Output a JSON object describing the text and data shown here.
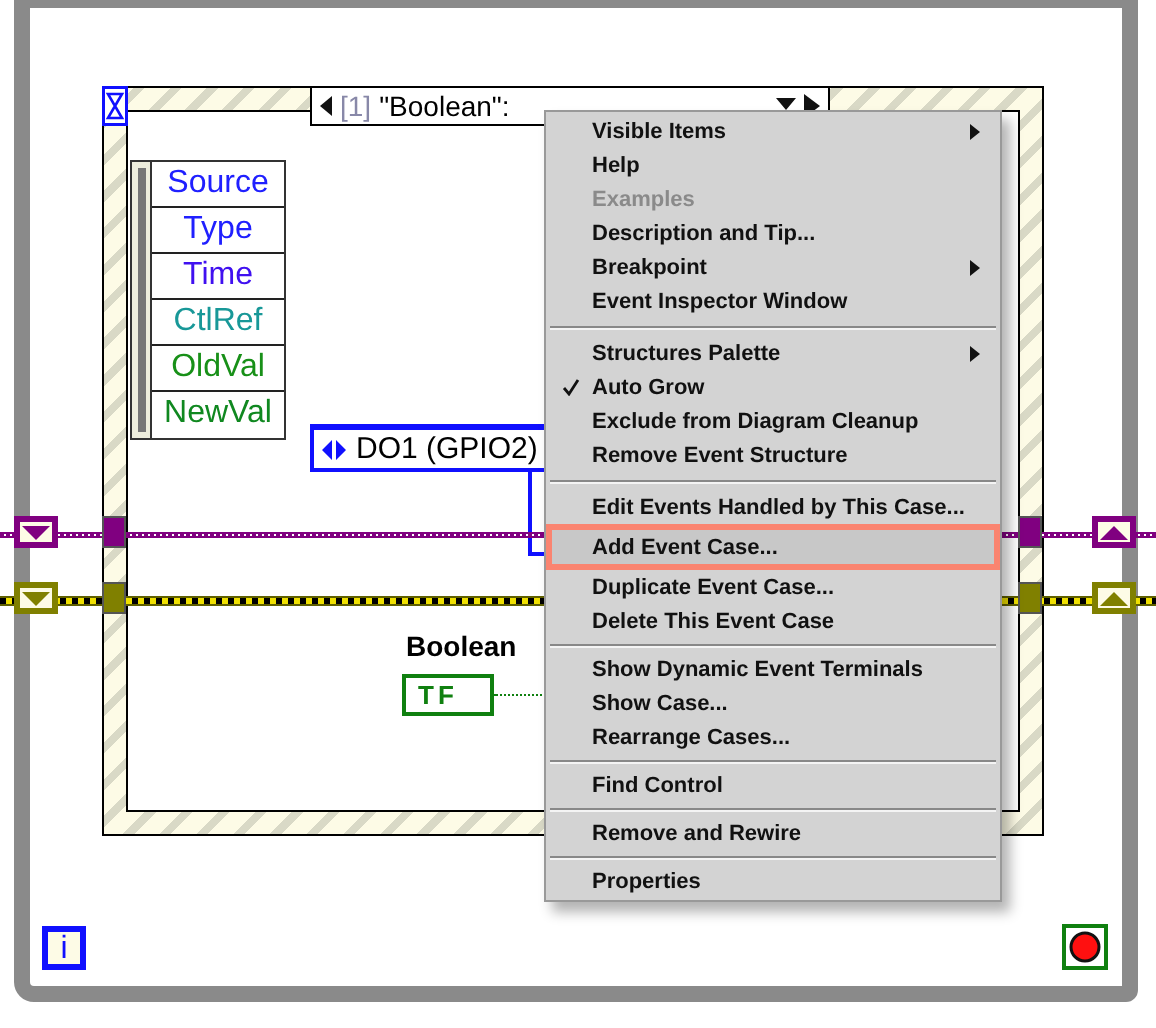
{
  "event_structure": {
    "selector": {
      "index": "[1]",
      "label": "\"Boolean\":"
    },
    "event_data": [
      {
        "label": "Source",
        "color": "#2020ff"
      },
      {
        "label": "Type",
        "color": "#2020ff"
      },
      {
        "label": "Time",
        "color": "#4010f0"
      },
      {
        "label": "CtlRef",
        "color": "#189898"
      },
      {
        "label": "OldVal",
        "color": "#189018"
      },
      {
        "label": "NewVal",
        "color": "#108820"
      }
    ],
    "reference_node": {
      "label": "DO1 (GPIO2)"
    },
    "control": {
      "label": "Boolean",
      "terminal": "TF"
    }
  },
  "shift_registers": [
    {
      "color": "#800080"
    },
    {
      "color": "#808000"
    }
  ],
  "iteration_terminal": "i",
  "context_menu": {
    "sections": [
      {
        "items": [
          {
            "label": "Visible Items",
            "submenu": true,
            "disabled": false,
            "checked": false,
            "highlighted": false
          },
          {
            "label": "Help",
            "submenu": false,
            "disabled": false,
            "checked": false,
            "highlighted": false
          },
          {
            "label": "Examples",
            "submenu": false,
            "disabled": true,
            "checked": false,
            "highlighted": false
          },
          {
            "label": "Description and Tip...",
            "submenu": false,
            "disabled": false,
            "checked": false,
            "highlighted": false
          },
          {
            "label": "Breakpoint",
            "submenu": true,
            "disabled": false,
            "checked": false,
            "highlighted": false
          },
          {
            "label": "Event Inspector Window",
            "submenu": false,
            "disabled": false,
            "checked": false,
            "highlighted": false
          }
        ]
      },
      {
        "items": [
          {
            "label": "Structures Palette",
            "submenu": true,
            "disabled": false,
            "checked": false,
            "highlighted": false
          },
          {
            "label": "Auto Grow",
            "submenu": false,
            "disabled": false,
            "checked": true,
            "highlighted": false
          },
          {
            "label": "Exclude from Diagram Cleanup",
            "submenu": false,
            "disabled": false,
            "checked": false,
            "highlighted": false
          },
          {
            "label": "Remove Event Structure",
            "submenu": false,
            "disabled": false,
            "checked": false,
            "highlighted": false
          }
        ]
      },
      {
        "items": [
          {
            "label": "Edit Events Handled by This Case...",
            "submenu": false,
            "disabled": false,
            "checked": false,
            "highlighted": false
          },
          {
            "label": "Add Event Case...",
            "submenu": false,
            "disabled": false,
            "checked": false,
            "highlighted": true
          },
          {
            "label": "Duplicate Event Case...",
            "submenu": false,
            "disabled": false,
            "checked": false,
            "highlighted": false
          },
          {
            "label": "Delete This Event Case",
            "submenu": false,
            "disabled": false,
            "checked": false,
            "highlighted": false
          }
        ]
      },
      {
        "items": [
          {
            "label": "Show Dynamic Event Terminals",
            "submenu": false,
            "disabled": false,
            "checked": false,
            "highlighted": false
          },
          {
            "label": "Show Case...",
            "submenu": false,
            "disabled": false,
            "checked": false,
            "highlighted": false
          },
          {
            "label": "Rearrange Cases...",
            "submenu": false,
            "disabled": false,
            "checked": false,
            "highlighted": false
          }
        ]
      },
      {
        "items": [
          {
            "label": "Find Control",
            "submenu": false,
            "disabled": false,
            "checked": false,
            "highlighted": false
          }
        ]
      },
      {
        "items": [
          {
            "label": "Remove and Rewire",
            "submenu": false,
            "disabled": false,
            "checked": false,
            "highlighted": false
          }
        ]
      },
      {
        "items": [
          {
            "label": "Properties",
            "submenu": false,
            "disabled": false,
            "checked": false,
            "highlighted": false
          }
        ]
      }
    ]
  }
}
